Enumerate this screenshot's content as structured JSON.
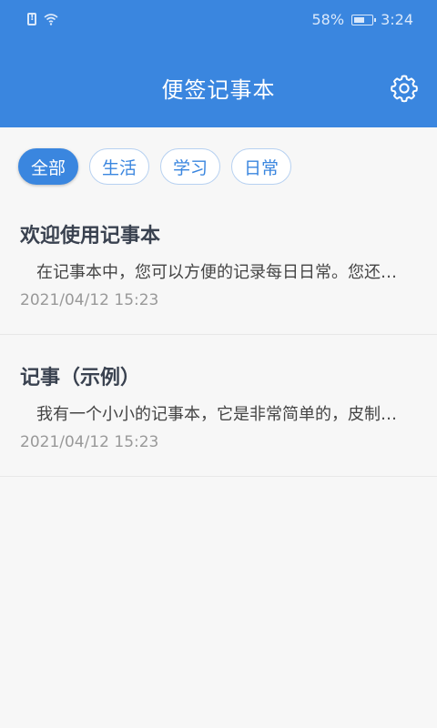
{
  "status_bar": {
    "battery": "58%",
    "time": "3:24"
  },
  "app_bar": {
    "title": "便签记事本",
    "settings_icon": "gear-icon"
  },
  "tabs": [
    {
      "label": "全部",
      "active": true
    },
    {
      "label": "生活",
      "active": false
    },
    {
      "label": "学习",
      "active": false
    },
    {
      "label": "日常",
      "active": false
    }
  ],
  "notes": [
    {
      "title": "欢迎使用记事本",
      "preview": "在记事本中，您可以方便的记录每日日常。您还…",
      "date": "2021/04/12 15:23"
    },
    {
      "title": "记事（示例）",
      "preview": "我有一个小小的记事本，它是非常简单的，皮制…",
      "date": "2021/04/12 15:23"
    }
  ],
  "colors": {
    "primary": "#3a86df",
    "background": "#f7f7f7",
    "title_text": "#3a4250",
    "date_text": "#999999"
  }
}
